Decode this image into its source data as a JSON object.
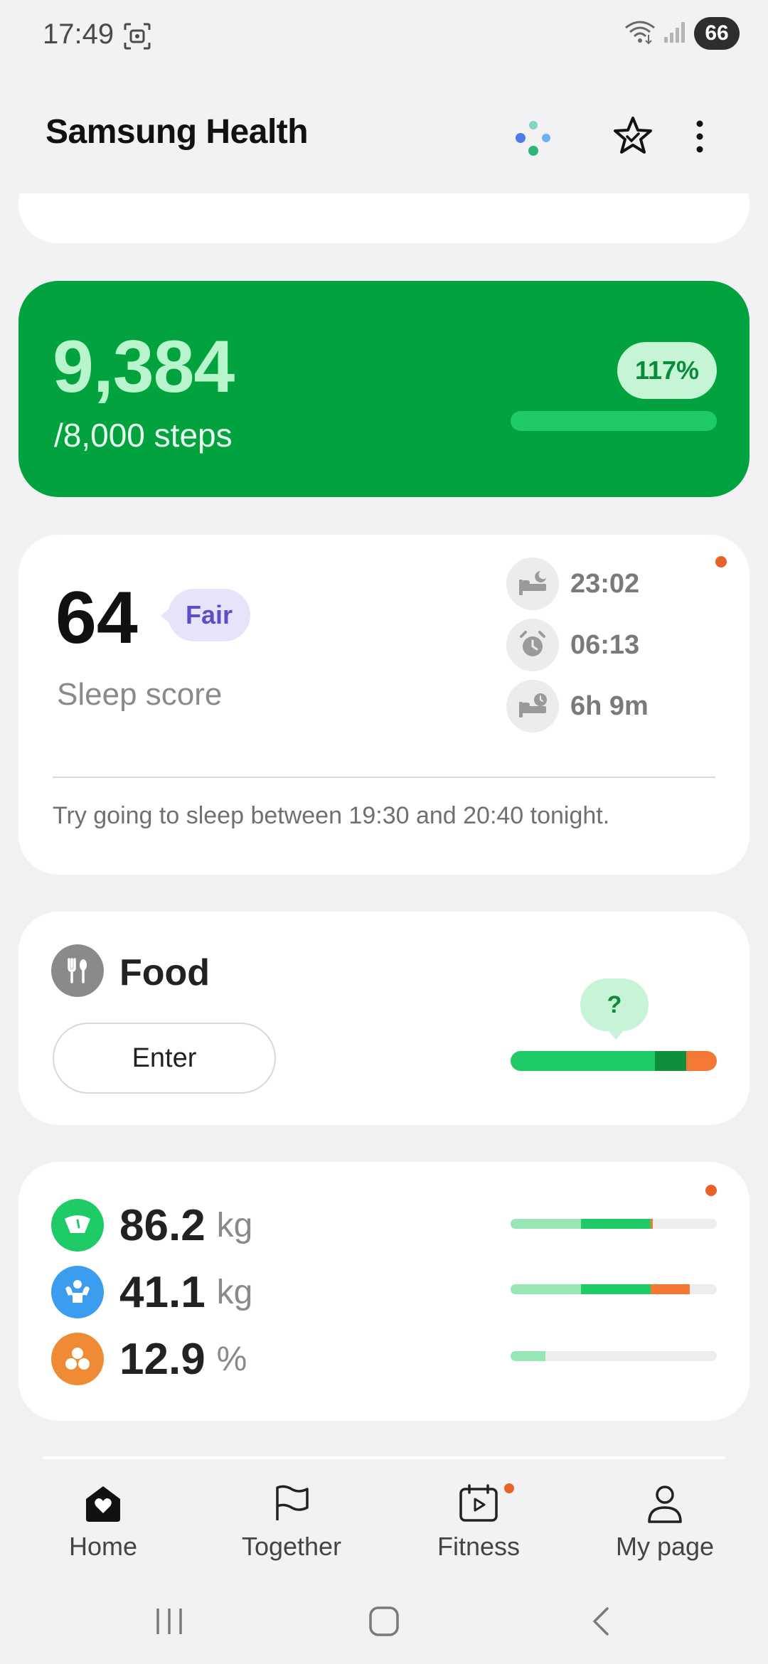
{
  "status_bar": {
    "time": "17:49",
    "battery": "66",
    "icons": [
      "screen-record-icon",
      "wifi-icon",
      "signal-icon",
      "battery-icon"
    ]
  },
  "header": {
    "title": "Samsung Health",
    "icons": [
      "ai-assistant-icon",
      "favorites-star-icon",
      "more-options-icon"
    ]
  },
  "steps": {
    "count": "9,384",
    "goal": "/8,000 steps",
    "percent_label": "117%",
    "progress": 1.0,
    "color": "#02a33e"
  },
  "sleep": {
    "score": "64",
    "rating": "Fair",
    "label": "Sleep score",
    "bedtime": "23:02",
    "wake_time": "06:13",
    "duration": "6h 9m",
    "tip": "Try going to sleep between 19:30 and 20:40 tonight."
  },
  "food": {
    "title": "Food",
    "enter_label": "Enter",
    "bubble": "?",
    "bar_segments": [
      {
        "fraction": 0.7,
        "color": "#1ecb67"
      },
      {
        "fraction": 0.15,
        "color": "#0f8f3c"
      },
      {
        "fraction": 0.15,
        "color": "#f27834"
      }
    ]
  },
  "body_composition": {
    "items": [
      {
        "name": "weight",
        "value": "86.2",
        "unit": "kg",
        "icon": "scale-icon",
        "icon_color": "#1ecb67",
        "bar_segments": [
          {
            "fraction": 0.34,
            "color": "#98e6b6"
          },
          {
            "fraction": 0.34,
            "color": "#1ecb67"
          },
          {
            "fraction": 0.01,
            "color": "#f27834"
          }
        ]
      },
      {
        "name": "skeletal-muscle",
        "value": "41.1",
        "unit": "kg",
        "icon": "muscle-icon",
        "icon_color": "#3b9cf0",
        "bar_segments": [
          {
            "fraction": 0.34,
            "color": "#98e6b6"
          },
          {
            "fraction": 0.34,
            "color": "#1ecb67"
          },
          {
            "fraction": 0.19,
            "color": "#f27834"
          }
        ]
      },
      {
        "name": "body-fat",
        "value": "12.9",
        "unit": "%",
        "icon": "body-fat-icon",
        "icon_color": "#ef8a35",
        "bar_segments": [
          {
            "fraction": 0.17,
            "color": "#98e6b6"
          }
        ]
      }
    ]
  },
  "bottom_nav": {
    "items": [
      {
        "label": "Home",
        "icon": "home-heart-icon",
        "active": true
      },
      {
        "label": "Together",
        "icon": "flag-icon",
        "active": false
      },
      {
        "label": "Fitness",
        "icon": "calendar-play-icon",
        "active": false,
        "badge": true
      },
      {
        "label": "My page",
        "icon": "person-icon",
        "active": false
      }
    ]
  },
  "system_nav": [
    "recents-icon",
    "home-icon",
    "back-icon"
  ]
}
